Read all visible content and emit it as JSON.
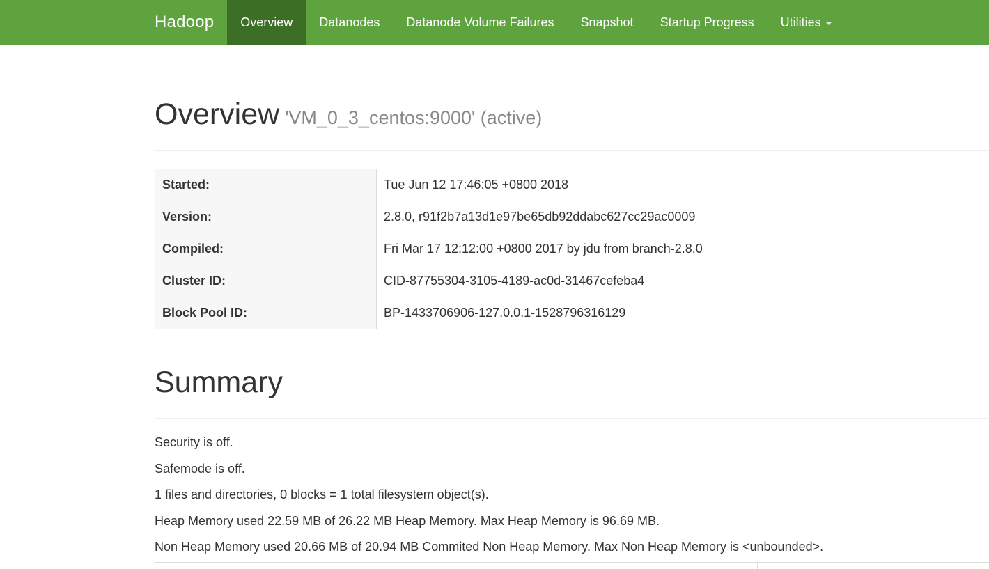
{
  "navbar": {
    "brand": "Hadoop",
    "items": [
      {
        "label": "Overview"
      },
      {
        "label": "Datanodes"
      },
      {
        "label": "Datanode Volume Failures"
      },
      {
        "label": "Snapshot"
      },
      {
        "label": "Startup Progress"
      },
      {
        "label": "Utilities"
      }
    ],
    "color": "#5fa33e",
    "active_color": "#3d6e25"
  },
  "overview": {
    "title": "Overview",
    "subtitle": "'VM_0_3_centos:9000' (active)"
  },
  "info_table": [
    {
      "key": "Started:",
      "value": "Tue Jun 12 17:46:05 +0800 2018"
    },
    {
      "key": "Version:",
      "value": "2.8.0, r91f2b7a13d1e97be65db92ddabc627cc29ac0009"
    },
    {
      "key": "Compiled:",
      "value": "Fri Mar 17 12:12:00 +0800 2017 by jdu from branch-2.8.0"
    },
    {
      "key": "Cluster ID:",
      "value": "CID-87755304-3105-4189-ac0d-31467cefeba4"
    },
    {
      "key": "Block Pool ID:",
      "value": "BP-1433706906-127.0.0.1-1528796316129"
    }
  ],
  "summary": {
    "title": "Summary",
    "lines": [
      "Security is off.",
      "Safemode is off.",
      "1 files and directories, 0 blocks = 1 total filesystem object(s).",
      "Heap Memory used 22.59 MB of 26.22 MB Heap Memory. Max Heap Memory is 96.69 MB.",
      "Non Heap Memory used 20.66 MB of 20.94 MB Commited Non Heap Memory. Max Non Heap Memory is <unbounded>."
    ]
  }
}
